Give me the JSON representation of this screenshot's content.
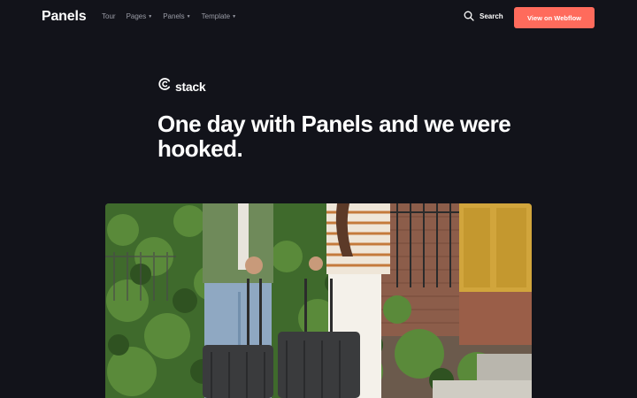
{
  "header": {
    "brand": "Panels",
    "menu": [
      {
        "label": "Tour",
        "has_dropdown": false
      },
      {
        "label": "Pages",
        "has_dropdown": true
      },
      {
        "label": "Panels",
        "has_dropdown": true
      },
      {
        "label": "Template",
        "has_dropdown": true
      }
    ],
    "search_label": "Search",
    "search_icon": "search-icon",
    "cta_label": "View on Webflow"
  },
  "hero": {
    "logo_text": "stack",
    "logo_icon": "stack-logo-icon",
    "headline": "One day with Panels and we were hooked."
  },
  "photo": {
    "subject": "two-people-with-luggage-photo"
  },
  "colors": {
    "background": "#12131a",
    "accent": "#ff6b5c",
    "text": "#ffffff",
    "muted": "#9a9ca6"
  }
}
